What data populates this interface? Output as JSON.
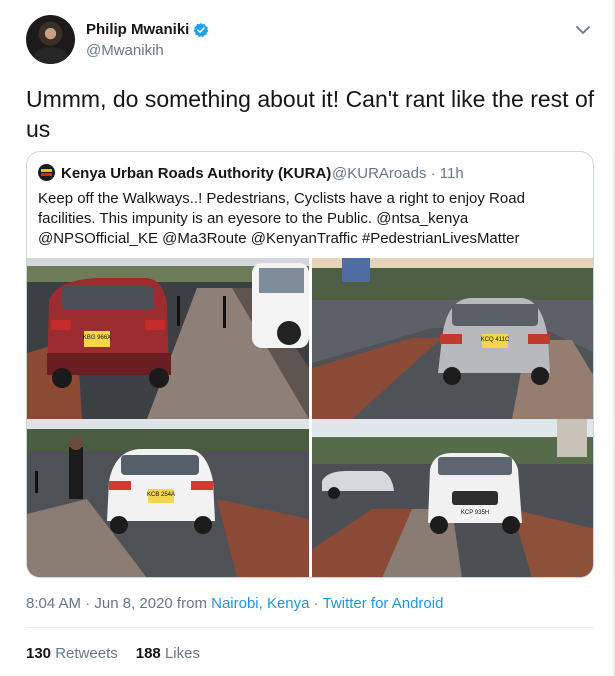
{
  "tweet": {
    "author_name": "Philip Mwaniki",
    "author_handle": "@Mwanikih",
    "text": "Ummm, do something about it! Can't rant like the rest of us",
    "timestamp": "8:04 AM · Jun 8, 2020",
    "from_word": " from ",
    "location": "Nairobi, Kenya",
    "separator": " · ",
    "source": "Twitter for Android",
    "retweets_count": "130",
    "retweets_label": "Retweets",
    "likes_count": "188",
    "likes_label": "Likes"
  },
  "quoted_tweet": {
    "author_name": "Kenya Urban Roads Authority (KURA)",
    "author_handle": "@KURAroads",
    "age": "· 11h",
    "text": "Keep off the Walkways..! Pedestrians, Cyclists have a right to enjoy Road facilities. This impunity is an eyesore to the Public. @ntsa_kenya @NPSOfficial_KE @Ma3Route @KenyanTraffic #PedestrianLivesMatter",
    "photos": [
      {
        "plate": "KBG 966X"
      },
      {
        "plate": "KCQ 411C"
      },
      {
        "plate": "KCB 254A"
      },
      {
        "plate": "KCP 935H"
      }
    ]
  },
  "colors": {
    "accent": "#1b95e0",
    "verified": "#1da1f2",
    "secondary_text": "#657786",
    "border": "#ccd6dd"
  },
  "icons": [
    "verified-badge-icon",
    "chevron-down-icon"
  ]
}
